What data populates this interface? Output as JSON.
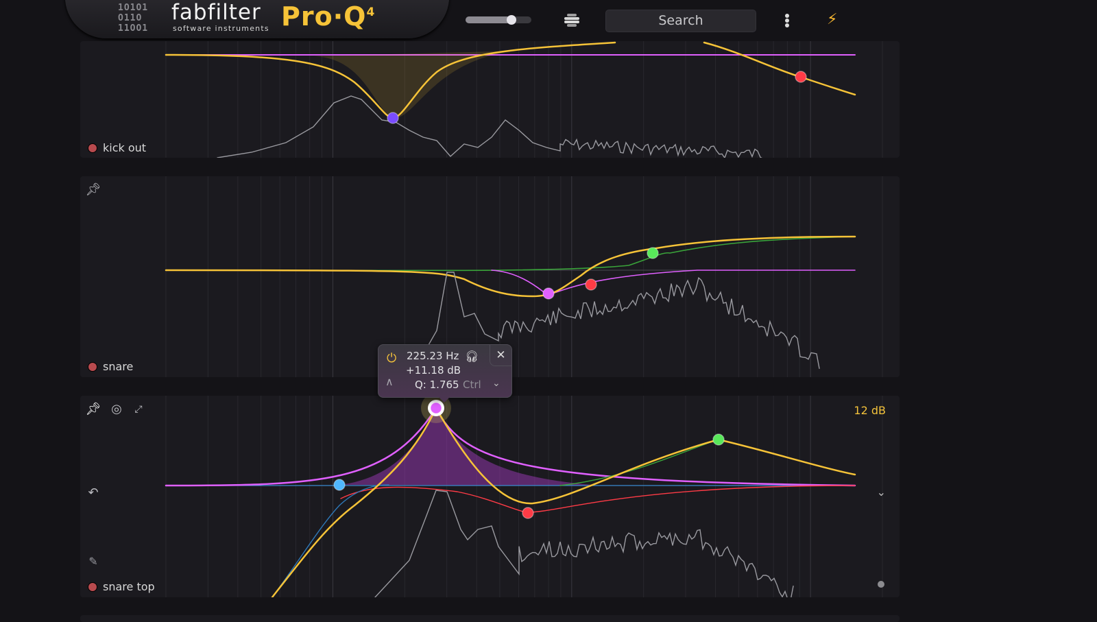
{
  "app": {
    "brand": "fabfilter",
    "brand_subtitle": "software instruments",
    "product": "Pro·Q",
    "product_version": "4",
    "logo_bits": [
      "1O1O1",
      "O11O",
      "11OO1"
    ]
  },
  "toolbar": {
    "output_level_fraction": 0.7,
    "menu_icon": "hamburger-stack-icon",
    "search_placeholder": "Search",
    "more_icon": "kebab-menu-icon",
    "instance_link_icon": "lightning-link-icon",
    "accent_color": "#f6c338"
  },
  "panels": [
    {
      "name": "kick out",
      "has_pin": false,
      "bands": [
        {
          "color": "#7a4cff",
          "type": "bell-cut"
        },
        {
          "color": "#ff3b46",
          "type": "high-shelf-down"
        }
      ]
    },
    {
      "name": "snare",
      "has_pin": true,
      "bands": [
        {
          "color": "#e060ff",
          "type": "bell-cut"
        },
        {
          "color": "#ff3b46",
          "type": "bell-cut"
        },
        {
          "color": "#58e85a",
          "type": "high-shelf-up"
        }
      ]
    },
    {
      "name": "snare top",
      "has_pin": true,
      "db_range": "12 dB",
      "bands": [
        {
          "color": "#4fb7ff",
          "type": "low-cut"
        },
        {
          "color": "#e060ff",
          "type": "bell-boost",
          "selected": true
        },
        {
          "color": "#ff3b46",
          "type": "bell-cut"
        },
        {
          "color": "#58e85a",
          "type": "bell-boost"
        }
      ]
    }
  ],
  "tooltip": {
    "frequency": "225.23 Hz",
    "gain": "+11.18 dB",
    "q": "Q: 1.765",
    "modifier_hint": "Ctrl",
    "power_icon": "power-icon",
    "solo_icon": "headphones-icon",
    "close_icon": "close-icon",
    "shape_icon": "bell-shape-icon",
    "more_icon": "chevron-down-icon"
  },
  "colors": {
    "eq_curve": "#f6c338",
    "spectrum": "#9a9aa0",
    "grid": "#2c2b31"
  }
}
